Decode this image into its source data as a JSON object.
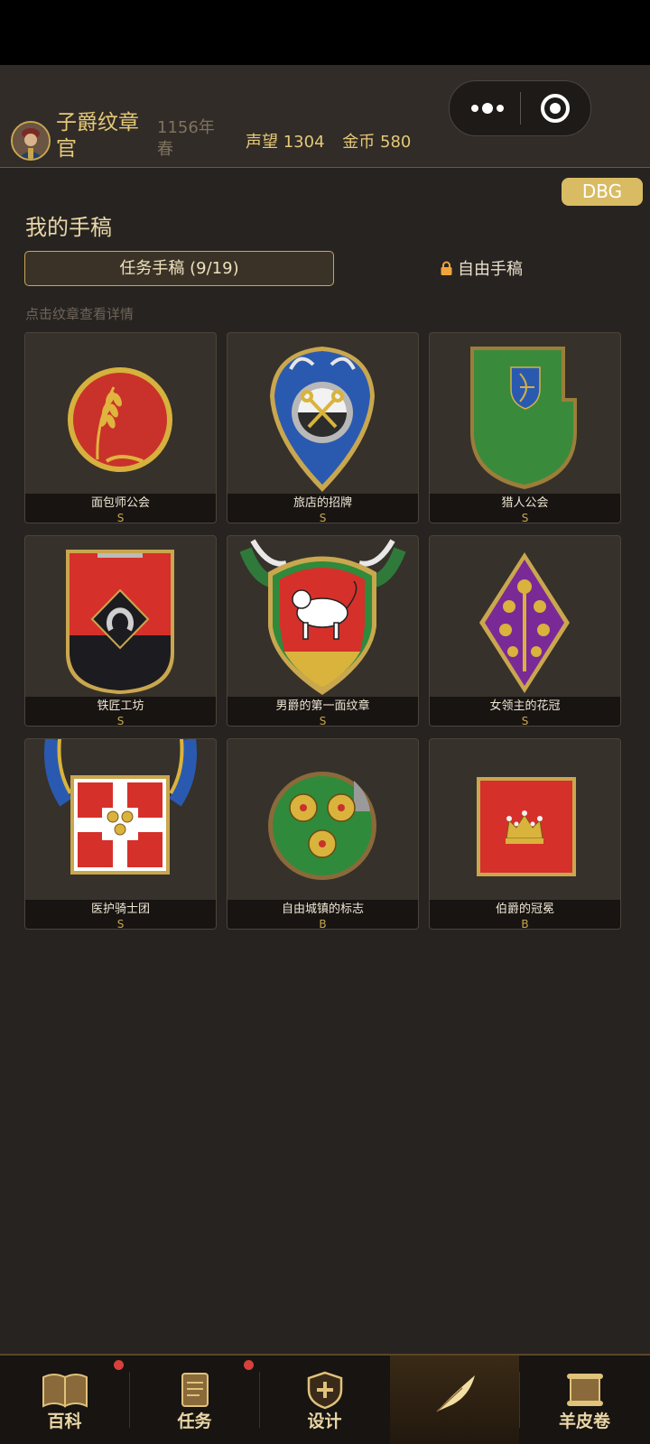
{
  "header": {
    "title": "子爵纹章官",
    "year": "1156年春",
    "reputation": "声望 1304",
    "gold": "金币 580"
  },
  "dbg_label": "DBG",
  "section_title": "我的手稿",
  "tabs": {
    "task": "任务手稿 (9/19)",
    "free": "自由手稿"
  },
  "hint": "点击纹章查看详情",
  "cards": [
    {
      "name": "面包师公会",
      "grade": "S"
    },
    {
      "name": "旅店的招牌",
      "grade": "S"
    },
    {
      "name": "猎人公会",
      "grade": "S"
    },
    {
      "name": "铁匠工坊",
      "grade": "S"
    },
    {
      "name": "男爵的第一面纹章",
      "grade": "S"
    },
    {
      "name": "女领主的花冠",
      "grade": "S"
    },
    {
      "name": "医护骑士团",
      "grade": "S"
    },
    {
      "name": "自由城镇的标志",
      "grade": "B"
    },
    {
      "name": "伯爵的冠冕",
      "grade": "B"
    }
  ],
  "bottom_nav": [
    {
      "label": "百科",
      "icon": "book-icon",
      "badge": true
    },
    {
      "label": "任务",
      "icon": "task-scroll-icon",
      "badge": true
    },
    {
      "label": "设计",
      "icon": "shield-design-icon",
      "badge": false
    },
    {
      "label": "",
      "icon": "quill-icon",
      "badge": false
    },
    {
      "label": "羊皮卷",
      "icon": "parchment-icon",
      "badge": false
    }
  ],
  "colors": {
    "gold": "#e5c977",
    "background": "#272320",
    "badge_red": "#d8403b"
  }
}
